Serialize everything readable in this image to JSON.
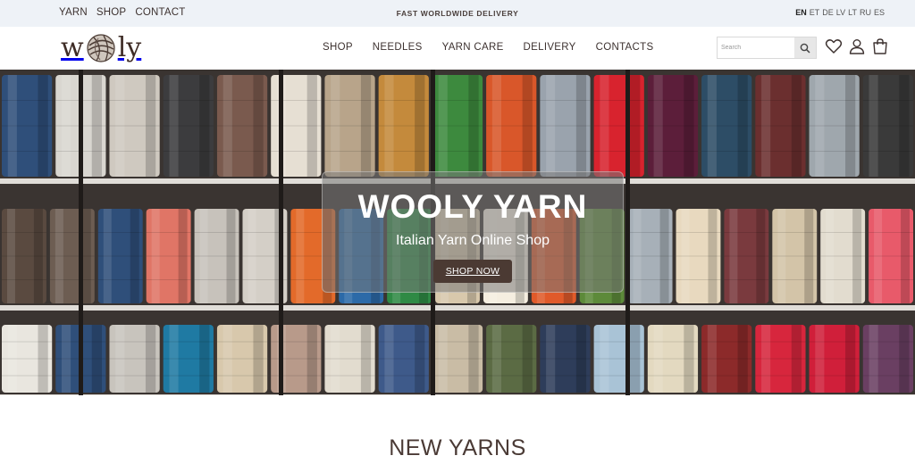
{
  "topbar": {
    "links": [
      "YARN",
      "SHOP",
      "CONTACT"
    ],
    "promo": "FAST WORLDWIDE DELIVERY",
    "languages": [
      "EN",
      "ET",
      "DE",
      "LV",
      "LT",
      "RU",
      "ES"
    ],
    "active_language": "EN"
  },
  "header": {
    "logo_text": "wooly",
    "logo_left": "w",
    "logo_right": "ly",
    "nav": [
      "SHOP",
      "NEEDLES",
      "YARN CARE",
      "DELIVERY",
      "CONTACTS"
    ],
    "search_placeholder": "Search",
    "icons": [
      "search-icon",
      "heart-icon",
      "user-icon",
      "cart-icon"
    ]
  },
  "hero": {
    "title": "WOOLY YARN",
    "subtitle": "Italian Yarn Online Shop",
    "button": "SHOP NOW"
  },
  "section": {
    "title": "NEW YARNS"
  },
  "colors": {
    "brand_dark": "#4b3a33",
    "topbar_bg": "#eef2f7",
    "text": "#3d3230"
  }
}
